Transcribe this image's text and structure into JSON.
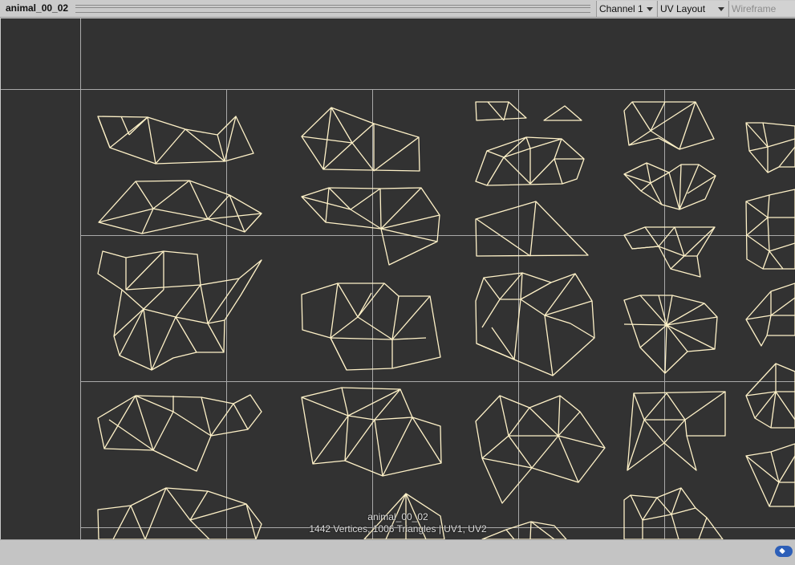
{
  "toolbar": {
    "title": "animal_00_02",
    "channel": "Channel 1",
    "layout": "UV Layout",
    "wireframe": "Wireframe"
  },
  "viewport": {
    "mesh_name": "animal_00_02",
    "mesh_stats": "1442 Vertices, 1006 Triangles | UV1, UV2"
  },
  "colors": {
    "background": "#323232",
    "wire": "#fff2c8",
    "grid": "#a9a9a9",
    "tag_icon": "#2d5fb8"
  },
  "icons": {
    "tag": "tag-icon"
  }
}
